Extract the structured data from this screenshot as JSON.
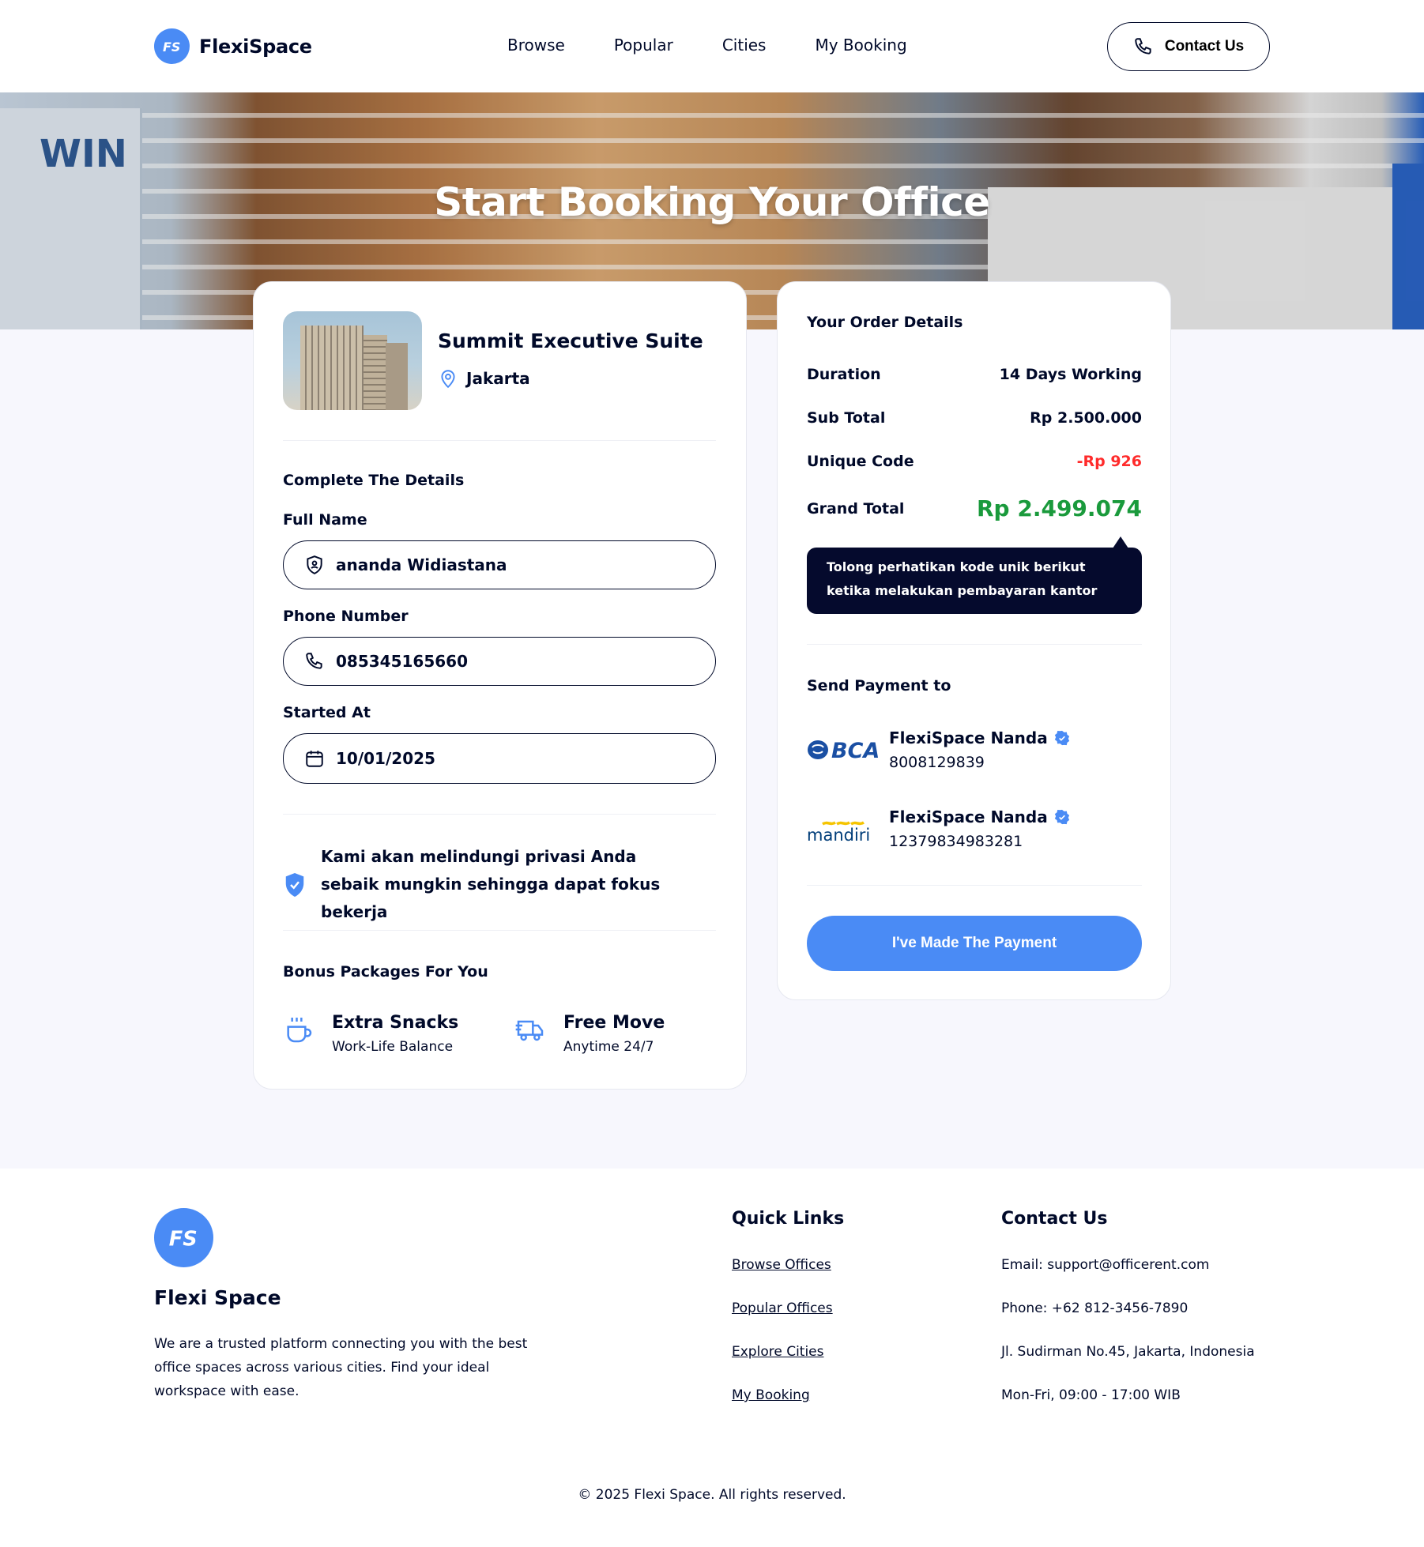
{
  "header": {
    "brand": "FlexiSpace",
    "nav": [
      "Browse",
      "Popular",
      "Cities",
      "My Booking"
    ],
    "contact_label": "Contact Us"
  },
  "hero": {
    "title": "Start Booking Your Office"
  },
  "office": {
    "name": "Summit Executive Suite",
    "city": "Jakarta"
  },
  "form": {
    "section_title": "Complete The Details",
    "full_name_label": "Full Name",
    "full_name_value": "ananda Widiastana",
    "phone_label": "Phone Number",
    "phone_value": "085345165660",
    "started_label": "Started At",
    "started_value": "10/01/2025",
    "privacy_text": "Kami akan melindungi privasi Anda sebaik mungkin sehingga dapat fokus bekerja"
  },
  "bonus": {
    "title": "Bonus Packages For You",
    "items": [
      {
        "title": "Extra Snacks",
        "subtitle": "Work-Life Balance",
        "icon": "coffee-cup-icon"
      },
      {
        "title": "Free Move",
        "subtitle": "Anytime 24/7",
        "icon": "truck-icon"
      }
    ]
  },
  "order": {
    "title": "Your Order Details",
    "duration_label": "Duration",
    "duration_value": "14 Days Working",
    "subtotal_label": "Sub Total",
    "subtotal_value": "Rp 2.500.000",
    "unique_label": "Unique Code",
    "unique_value": "-Rp 926",
    "grand_label": "Grand Total",
    "grand_value": "Rp 2.499.074",
    "tooltip": "Tolong perhatikan kode unik berikut ketika melakukan pembayaran kantor"
  },
  "payment": {
    "title": "Send Payment to",
    "banks": [
      {
        "logo_text": "BCA",
        "name": "FlexiSpace Nanda",
        "account": "8008129839"
      },
      {
        "logo_text": "mandiri",
        "name": "FlexiSpace Nanda",
        "account": "12379834983281"
      }
    ],
    "button_label": "I've Made The Payment"
  },
  "footer": {
    "brand": "Flexi Space",
    "description": "We are a trusted platform connecting you with the best office spaces across various cities. Find your ideal workspace with ease.",
    "quick_links_title": "Quick Links",
    "quick_links": [
      "Browse Offices",
      "Popular Offices",
      "Explore Cities",
      "My Booking"
    ],
    "contact_title": "Contact Us",
    "contact": [
      "Email: support@officerent.com",
      "Phone: +62 812-3456-7890",
      "Jl. Sudirman No.45, Jakarta, Indonesia",
      "Mon-Fri, 09:00 - 17:00 WIB"
    ],
    "copyright": "© 2025 Flexi Space. All rights reserved."
  },
  "colors": {
    "accent": "#4a8bf5",
    "navy": "#000929",
    "success": "#1a9a3c",
    "danger": "#ff2b2b",
    "background": "#f7f7fd"
  }
}
